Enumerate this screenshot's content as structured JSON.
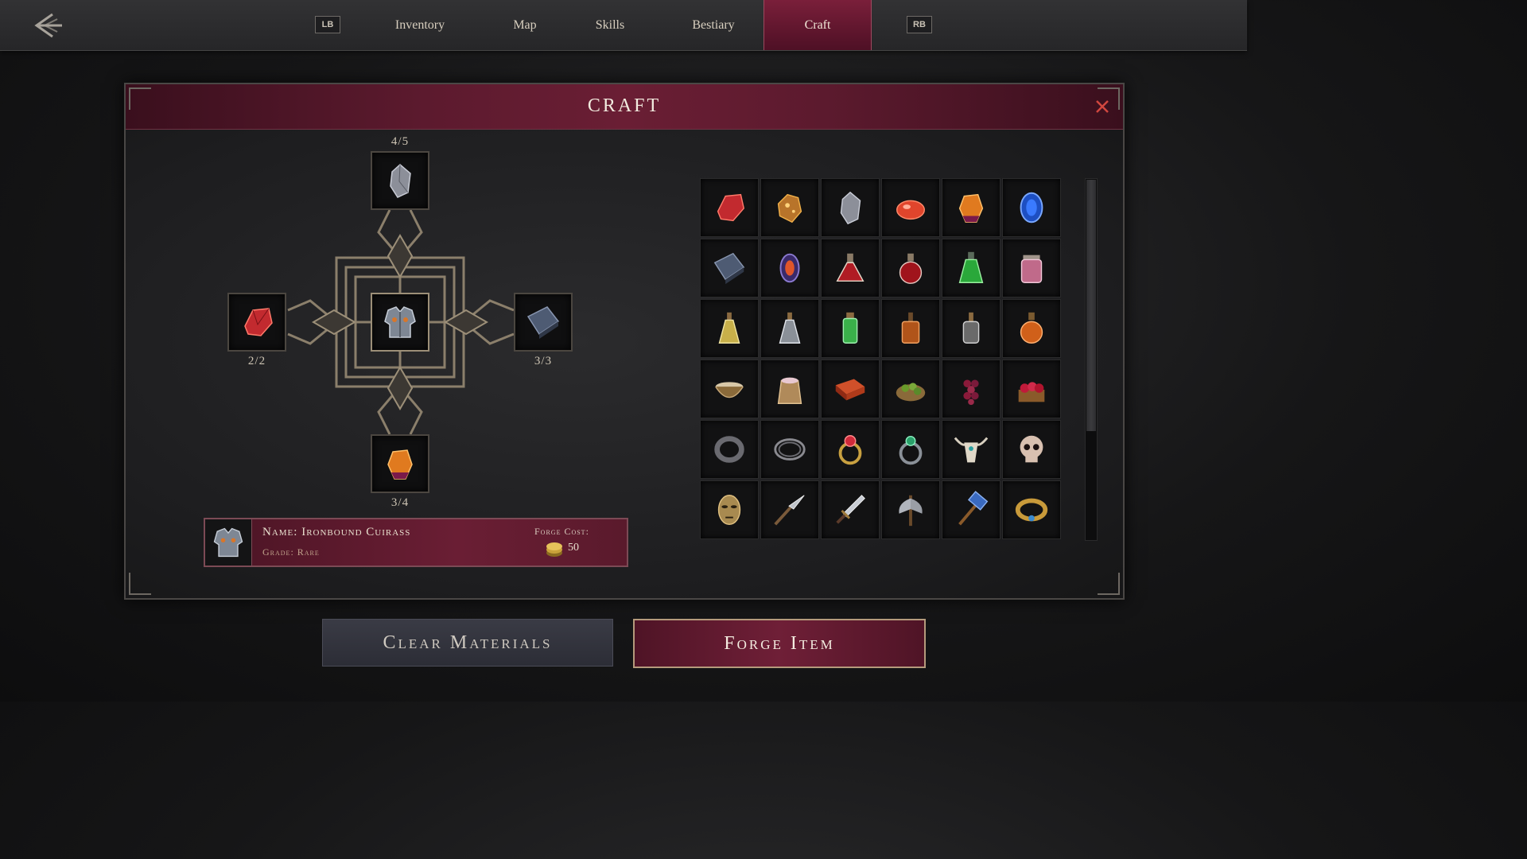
{
  "nav": {
    "lb": "LB",
    "rb": "RB",
    "tabs": [
      {
        "label": "Inventory",
        "active": false
      },
      {
        "label": "Map",
        "active": false
      },
      {
        "label": "Skills",
        "active": false
      },
      {
        "label": "Bestiary",
        "active": false
      },
      {
        "label": "Craft",
        "active": true
      }
    ]
  },
  "panel": {
    "title": "CRAFT"
  },
  "recipe": {
    "center": {
      "icon": "cuirass-icon"
    },
    "top": {
      "icon": "silver-ore-icon",
      "count": "4/5"
    },
    "left": {
      "icon": "red-crystal-icon",
      "count": "2/2"
    },
    "right": {
      "icon": "iron-ingot-icon",
      "count": "3/3"
    },
    "bottom": {
      "icon": "amber-shard-icon",
      "count": "3/4"
    }
  },
  "item_info": {
    "name": "Name: Ironbound Cuirass",
    "grade": "Grade: Rare",
    "cost_label": "Forge Cost:",
    "cost": "50"
  },
  "materials": [
    [
      "red-crystal-icon",
      "gold-ore-icon",
      "silver-ore-icon",
      "red-gel-icon",
      "amber-shard-icon",
      "sapphire-icon"
    ],
    [
      "iron-ingot-icon",
      "fire-opal-icon",
      "red-flask-icon",
      "red-potion-icon",
      "green-potion-icon",
      "pink-salt-jar-icon"
    ],
    [
      "yellow-vial-icon",
      "clear-vial-icon",
      "green-vial-icon",
      "amber-bottle-icon",
      "empty-bottle-icon",
      "orange-bottle-icon"
    ],
    [
      "bowl-icon",
      "flour-sack-icon",
      "brick-icon",
      "olive-basket-icon",
      "grapes-icon",
      "berry-basket-icon"
    ],
    [
      "iron-band-icon",
      "coil-ring-icon",
      "ruby-ring-icon",
      "emerald-ring-icon",
      "bull-skull-icon",
      "skull-icon"
    ],
    [
      "bronze-mask-icon",
      "spear-tip-icon",
      "dagger-icon",
      "battle-axe-icon",
      "warhammer-icon",
      "gold-bracelet-icon"
    ]
  ],
  "buttons": {
    "clear": "Clear Materials",
    "forge": "Forge Item"
  },
  "colors": {
    "accent": "#6a1e34",
    "gold": "#b59a7c",
    "slate": "#2c2d36"
  }
}
